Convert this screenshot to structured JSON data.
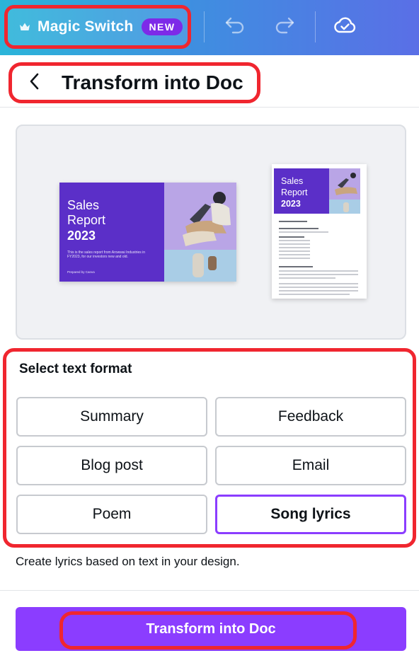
{
  "toolbar": {
    "magic_switch_label": "Magic Switch",
    "new_badge": "NEW",
    "icons": [
      "crown-icon",
      "undo-icon",
      "redo-icon",
      "cloud-check-icon"
    ]
  },
  "header": {
    "title": "Transform into Doc",
    "back_icon": "chevron-left-icon"
  },
  "preview": {
    "slide": {
      "title_line1": "Sales",
      "title_line2": "Report",
      "year": "2023",
      "description": "This is the sales report from Arowwai Industries in FY2023, for our investors new and old.",
      "byline": "Prepared by Canva"
    },
    "doc": {
      "title_line1": "Sales",
      "title_line2": "Report",
      "year": "2023"
    }
  },
  "format": {
    "label": "Select text format",
    "options": [
      {
        "label": "Summary",
        "selected": false
      },
      {
        "label": "Feedback",
        "selected": false
      },
      {
        "label": "Blog post",
        "selected": false
      },
      {
        "label": "Email",
        "selected": false
      },
      {
        "label": "Poem",
        "selected": false
      },
      {
        "label": "Song lyrics",
        "selected": true
      }
    ]
  },
  "helper_text": "Create lyrics based on text in your design.",
  "cta": {
    "label": "Transform into Doc"
  },
  "colors": {
    "accent": "#8b3dff",
    "annotation_red": "#f0262f",
    "slide_purple": "#5b2fc8"
  }
}
